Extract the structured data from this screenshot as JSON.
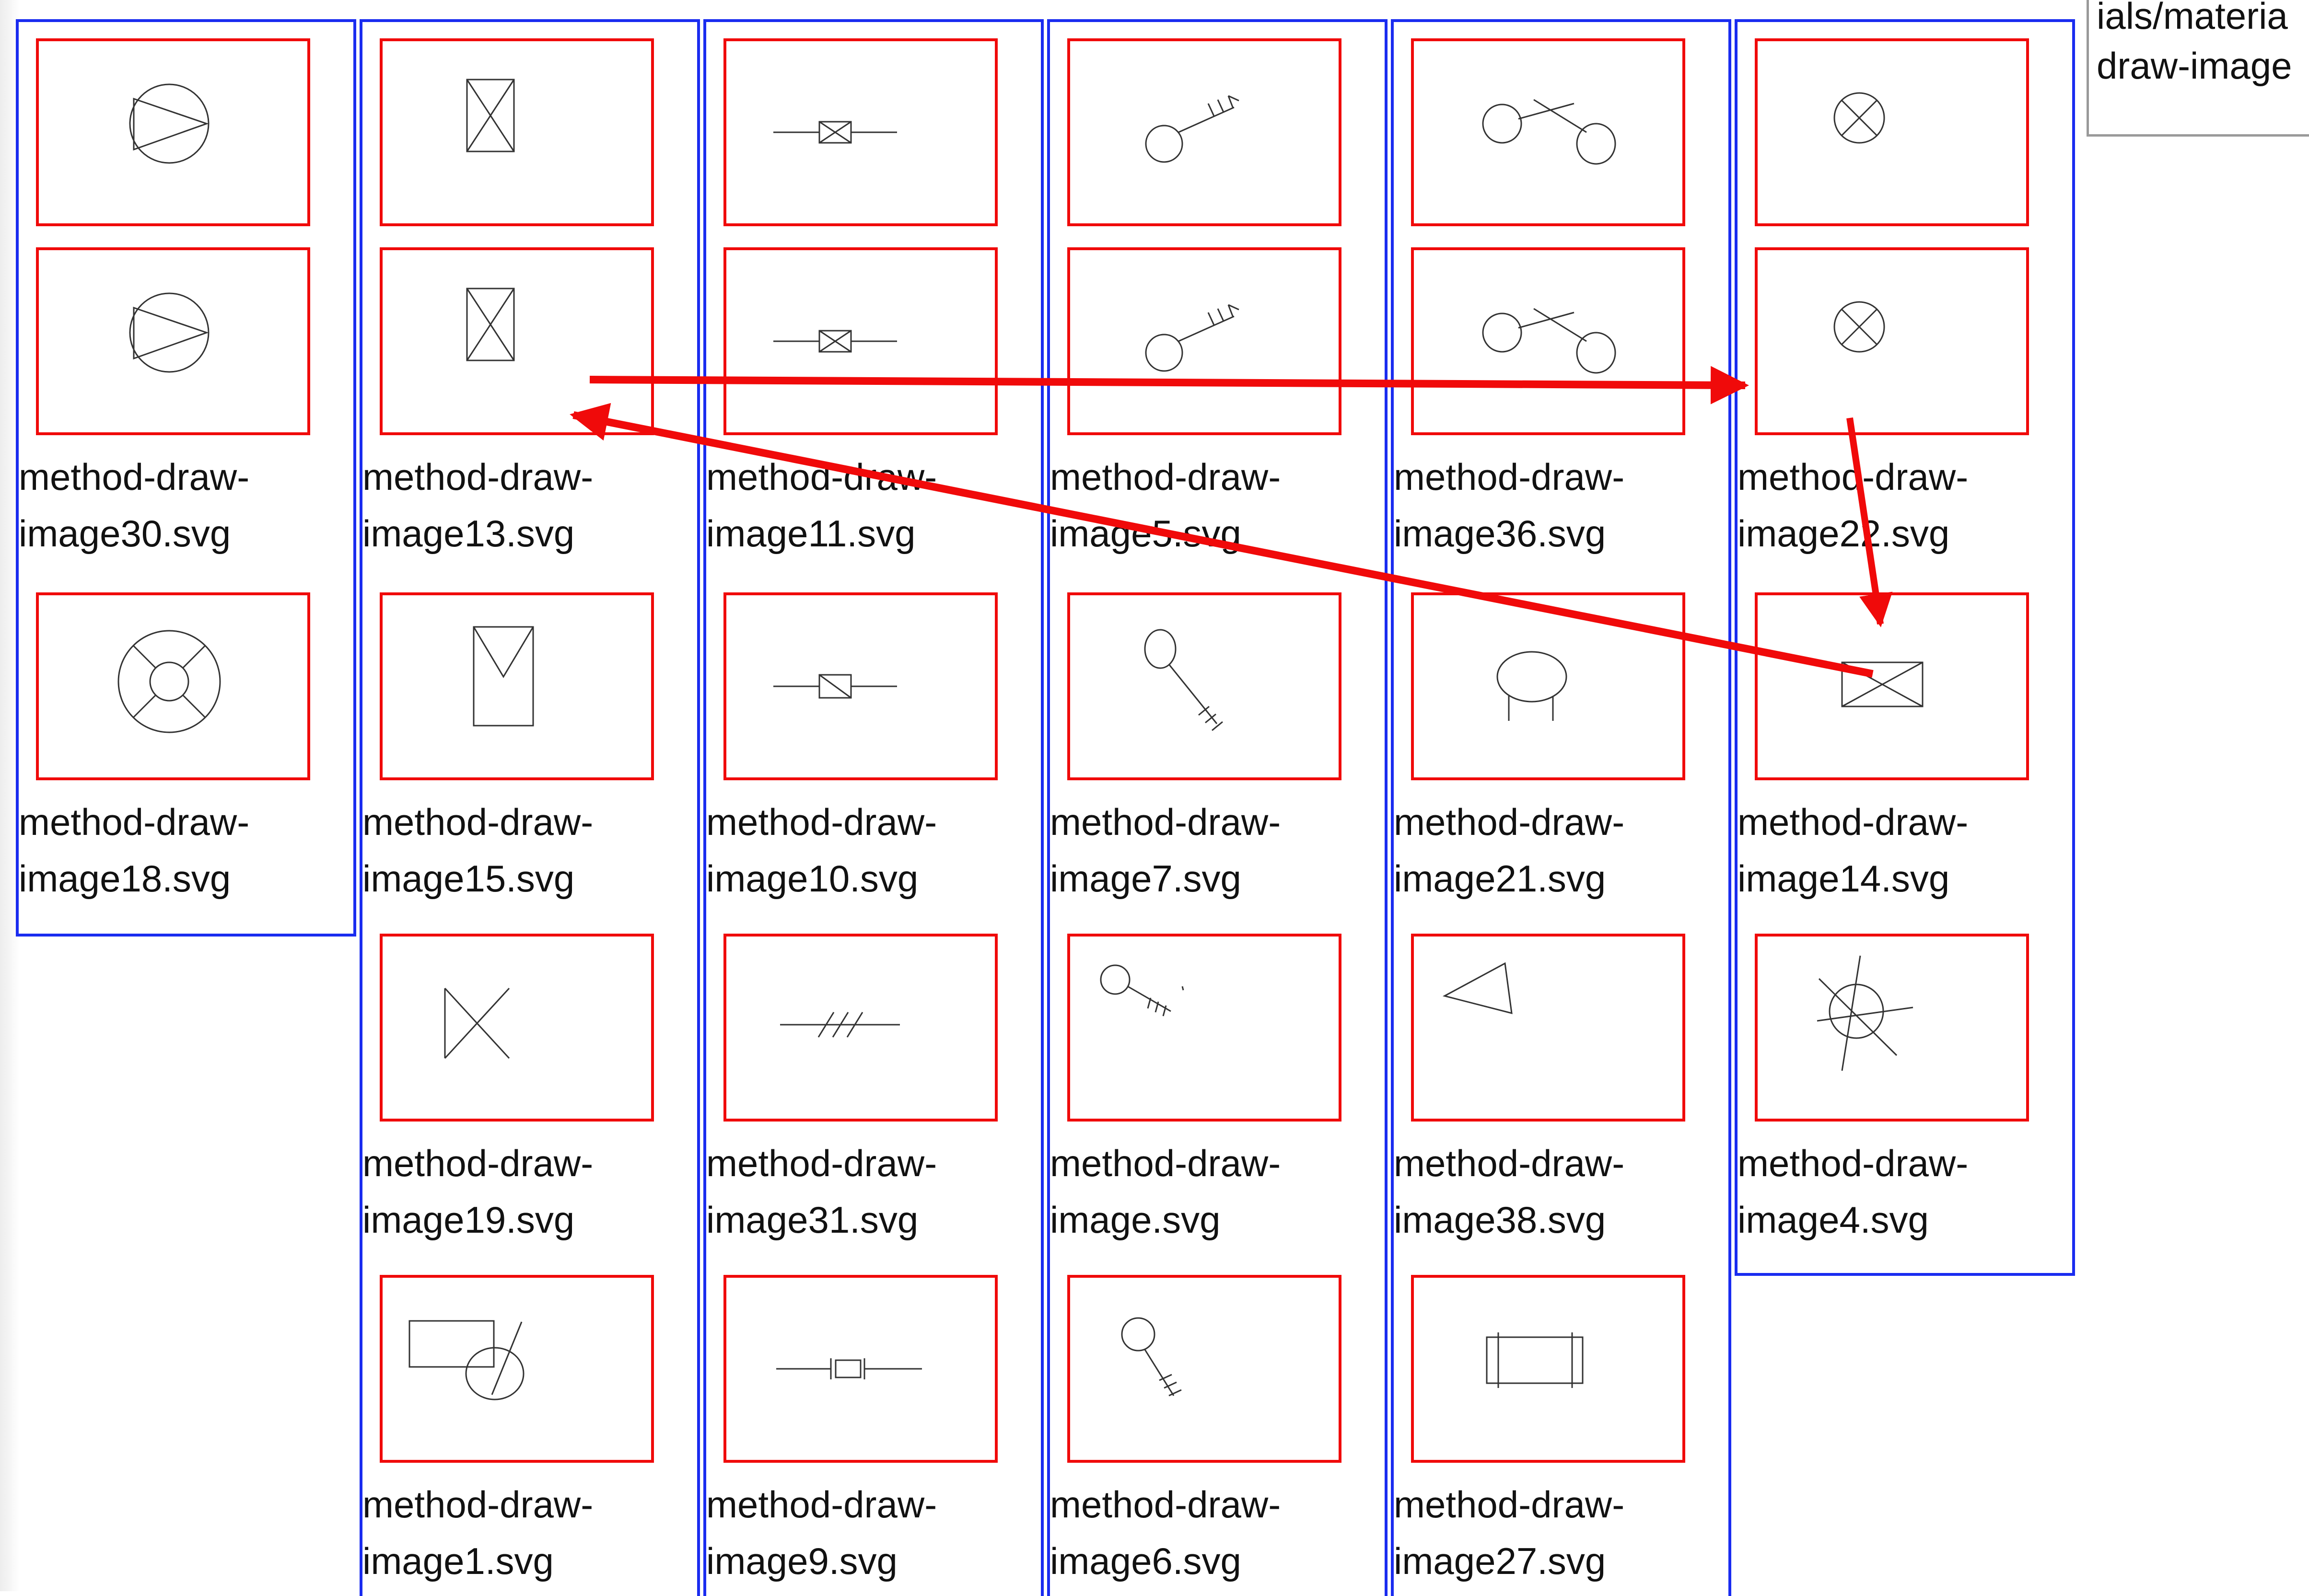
{
  "path_box": {
    "line1": "ials/materia",
    "line2": "draw-image"
  },
  "columns": [
    {
      "id": "col1",
      "items": [
        {
          "icon": "triangle-in-circle-icon",
          "label_top": "",
          "label": [
            "",
            ""
          ]
        },
        {
          "icon": "triangle-in-circle-icon",
          "label": [
            "method-draw-",
            "image30.svg"
          ]
        },
        {
          "icon": "lifebuoy-circle-icon",
          "label": [
            "method-draw-",
            "image18.svg"
          ]
        }
      ]
    },
    {
      "id": "col2",
      "items": [
        {
          "icon": "crossed-rectangle-icon",
          "label": [
            "",
            ""
          ]
        },
        {
          "icon": "crossed-rectangle-icon",
          "label": [
            "method-draw-",
            "image13.svg"
          ]
        },
        {
          "icon": "rectangle-v-icon",
          "label": [
            "method-draw-",
            "image15.svg"
          ]
        },
        {
          "icon": "bowtie-cross-icon",
          "label": [
            "method-draw-",
            "image19.svg"
          ]
        },
        {
          "icon": "rect-circle-slash-icon",
          "label": [
            "method-draw-",
            "image1.svg"
          ]
        }
      ]
    },
    {
      "id": "col3",
      "items": [
        {
          "icon": "inline-crossed-box-icon",
          "label": [
            "",
            ""
          ]
        },
        {
          "icon": "inline-crossed-box-icon",
          "label": [
            "method-draw-",
            "image11.svg"
          ]
        },
        {
          "icon": "inline-small-box-icon",
          "label": [
            "method-draw-",
            "image10.svg"
          ]
        },
        {
          "icon": "hatched-line-icon",
          "label": [
            "method-draw-",
            "image31.svg"
          ]
        },
        {
          "icon": "inline-capacitor-icon",
          "label": [
            "method-draw-",
            "image9.svg"
          ]
        }
      ]
    },
    {
      "id": "col4",
      "items": [
        {
          "icon": "key-up-icon",
          "label": [
            "",
            ""
          ]
        },
        {
          "icon": "key-up-icon",
          "label": [
            "method-draw-",
            "image5.svg"
          ]
        },
        {
          "icon": "key-down-icon",
          "label": [
            "method-draw-",
            "image7.svg"
          ]
        },
        {
          "icon": "key-side-icon",
          "label": [
            "method-draw-",
            "image.svg"
          ]
        },
        {
          "icon": "key-vertical-icon",
          "label": [
            "method-draw-",
            "image6.svg"
          ]
        }
      ]
    },
    {
      "id": "col5",
      "items": [
        {
          "icon": "two-circles-cross-icon",
          "label": [
            "",
            ""
          ]
        },
        {
          "icon": "two-circles-cross-icon",
          "label": [
            "method-draw-",
            "image36.svg"
          ]
        },
        {
          "icon": "ellipse-legs-icon",
          "label": [
            "method-draw-",
            "image21.svg"
          ]
        },
        {
          "icon": "triangle-icon",
          "label": [
            "method-draw-",
            "image38.svg"
          ]
        },
        {
          "icon": "rectangle-bars-icon",
          "label": [
            "method-draw-",
            "image27.svg"
          ]
        }
      ]
    },
    {
      "id": "col6",
      "items": [
        {
          "icon": "circle-x-icon",
          "label": [
            "",
            ""
          ]
        },
        {
          "icon": "circle-x-icon",
          "label": [
            "method-draw-",
            "image22.svg"
          ]
        },
        {
          "icon": "envelope-box-icon",
          "label": [
            "method-draw-",
            "image14.svg"
          ]
        },
        {
          "icon": "circle-burst-icon",
          "label": [
            "method-draw-",
            "image4.svg"
          ]
        }
      ]
    }
  ],
  "colors": {
    "column_border": "#1a2cf0",
    "thumb_border": "#f00a0a",
    "arrow": "#f00a0a"
  }
}
